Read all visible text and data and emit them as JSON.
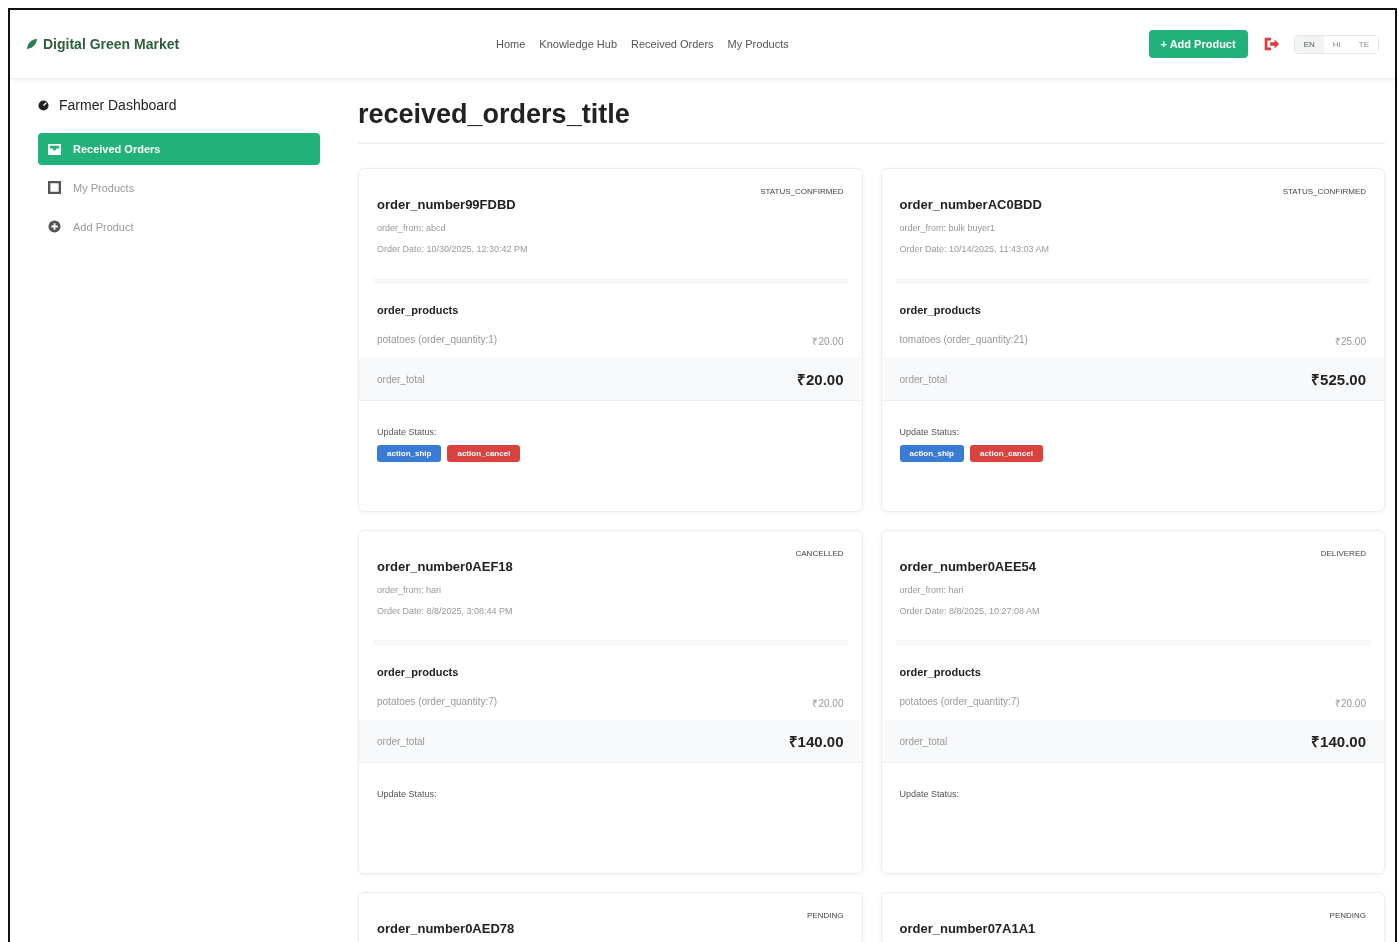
{
  "header": {
    "brand": "Digital Green Market",
    "nav": [
      {
        "label": "Home"
      },
      {
        "label": "Knowledge Hub"
      },
      {
        "label": "Received Orders"
      },
      {
        "label": "My Products"
      }
    ],
    "add_button": "+ Add Product",
    "languages": [
      {
        "label": "EN",
        "selected": true
      },
      {
        "label": "HI",
        "selected": false
      },
      {
        "label": "TE",
        "selected": false
      }
    ]
  },
  "sidebar": {
    "title": "Farmer Dashboard",
    "items": [
      {
        "label": "Received Orders",
        "kind": "orders",
        "selected": true
      },
      {
        "label": "My Products",
        "kind": "products",
        "selected": false
      },
      {
        "label": "Add Product",
        "kind": "add",
        "selected": false
      }
    ]
  },
  "page_title": "received_orders_title",
  "orders": [
    {
      "number": "order_number99FDBD",
      "status": "STATUS_CONFIRMED",
      "from": "order_from: abcd",
      "date": "Order Date: 10/30/2025, 12:30:42 PM",
      "products_label": "order_products",
      "products": [
        {
          "name": "potatoes (order_quantity:1)",
          "price": "₹20.00"
        }
      ],
      "total_label": "order_total",
      "total": "₹20.00",
      "update_label": "Update Status:",
      "actions": [
        {
          "label": "action_ship",
          "kind": "ship"
        },
        {
          "label": "action_cancel",
          "kind": "cancel"
        }
      ]
    },
    {
      "number": "order_numberAC0BDD",
      "status": "STATUS_CONFIRMED",
      "from": "order_from: bulk buyer1",
      "date": "Order Date: 10/14/2025, 11:43:03 AM",
      "products_label": "order_products",
      "products": [
        {
          "name": "tomatoes (order_quantity:21)",
          "price": "₹25.00"
        }
      ],
      "total_label": "order_total",
      "total": "₹525.00",
      "update_label": "Update Status:",
      "actions": [
        {
          "label": "action_ship",
          "kind": "ship"
        },
        {
          "label": "action_cancel",
          "kind": "cancel"
        }
      ]
    },
    {
      "number": "order_number0AEF18",
      "status": "CANCELLED",
      "from": "order_from: hari",
      "date": "Order Date: 8/8/2025, 3:08:44 PM",
      "products_label": "order_products",
      "products": [
        {
          "name": "potatoes (order_quantity:7)",
          "price": "₹20.00"
        }
      ],
      "total_label": "order_total",
      "total": "₹140.00",
      "update_label": "Update Status:"
    },
    {
      "number": "order_number0AEE54",
      "status": "DELIVERED",
      "from": "order_from: hari",
      "date": "Order Date: 8/8/2025, 10:27:08 AM",
      "products_label": "order_products",
      "products": [
        {
          "name": "potatoes (order_quantity:7)",
          "price": "₹20.00"
        }
      ],
      "total_label": "order_total",
      "total": "₹140.00",
      "update_label": "Update Status:"
    },
    {
      "number": "order_number0AED78",
      "status": "PENDING"
    },
    {
      "number": "order_number07A1A1",
      "status": "PENDING"
    }
  ]
}
